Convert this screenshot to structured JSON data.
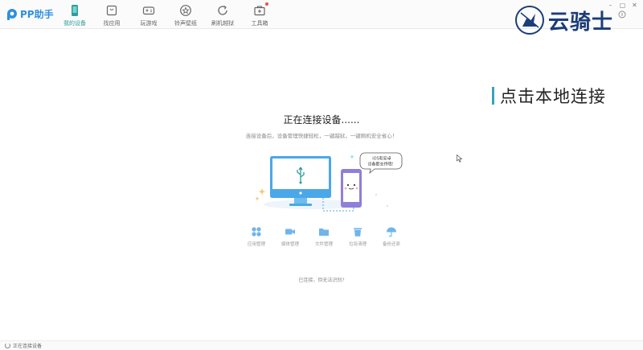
{
  "app": {
    "name": "PP助手"
  },
  "nav": {
    "items": [
      {
        "label": "我的设备",
        "icon": "phone-icon",
        "active": true
      },
      {
        "label": "找应用",
        "icon": "app-icon",
        "active": false
      },
      {
        "label": "玩游戏",
        "icon": "gamepad-icon",
        "active": false
      },
      {
        "label": "铃声壁纸",
        "icon": "star-icon",
        "active": false
      },
      {
        "label": "刷机越狱",
        "icon": "refresh-icon",
        "active": false
      },
      {
        "label": "工具箱",
        "icon": "toolbox-icon",
        "active": false,
        "badge": true
      }
    ]
  },
  "watermark": {
    "text": "云骑士"
  },
  "side_banner": {
    "text": "点击本地连接"
  },
  "main": {
    "title": "正在连接设备......",
    "subtitle": "连接设备后，设备管理快捷轻松，一键越狱，一键刷机安全省心！",
    "bubble": "iOS和安卓\n设备都支持哦！",
    "features": [
      {
        "label": "应用管理",
        "icon": "grid-icon"
      },
      {
        "label": "媒体管理",
        "icon": "video-icon"
      },
      {
        "label": "文件管理",
        "icon": "folder-icon"
      },
      {
        "label": "垃圾清理",
        "icon": "trash-icon"
      },
      {
        "label": "备份还原",
        "icon": "umbrella-icon"
      }
    ],
    "help_prefix": "已连接，",
    "help_link": "但无法识别?"
  },
  "status": {
    "text": "正在连接设备"
  },
  "colors": {
    "accent": "#2a9e9a",
    "brand": "#2f8fe0",
    "illustration": "#4aa8e8"
  }
}
